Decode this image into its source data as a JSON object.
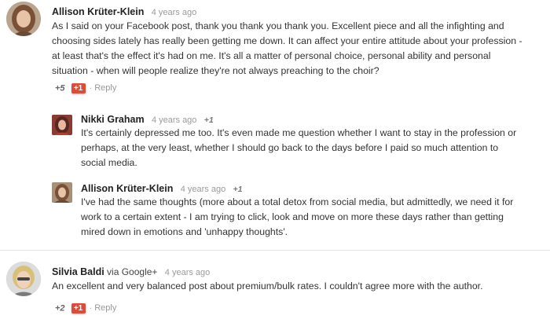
{
  "comments": [
    {
      "author": "Allison Krüter-Klein",
      "time": "4 years ago",
      "text": "As I said on your Facebook post, thank you thank you thank you. Excellent piece and all the infighting and choosing sides lately has really been getting me down. It can affect your entire attitude about your profession - at least that's the effect it's had on me. It's all a matter of personal choice, personal ability and personal situation - when will people realize they're not always preaching to the choir?",
      "score": "+5",
      "plus_label": "+1",
      "separator": "·",
      "reply_label": "Reply"
    },
    {
      "author": "Nikki Graham",
      "time": "4 years ago",
      "plus_inline": "+1",
      "text": "It's certainly depressed me too. It's even made me question whether I want to stay in the profession or perhaps, at the very least, whether I should go back to the days before I paid so much attention to social media."
    },
    {
      "author": "Allison Krüter-Klein",
      "time": "4 years ago",
      "plus_inline": "+1",
      "text": "I've had the same thoughts (more about a total detox from social media, but admittedly, we need it for work to a certain extent - I am trying to click, look and move on more these days rather than getting mired down in emotions and 'unhappy thoughts'."
    },
    {
      "author": "Silvia Baldi",
      "via": "via Google+",
      "time": "4 years ago",
      "text": "An excellent and very balanced post about premium/bulk rates. I couldn't agree more with the author.",
      "score": "+2",
      "plus_label": "+1",
      "separator": "·",
      "reply_label": "Reply"
    }
  ],
  "colors": {
    "plus_button": "#dd4b39",
    "divider": "#e3e3e3"
  }
}
